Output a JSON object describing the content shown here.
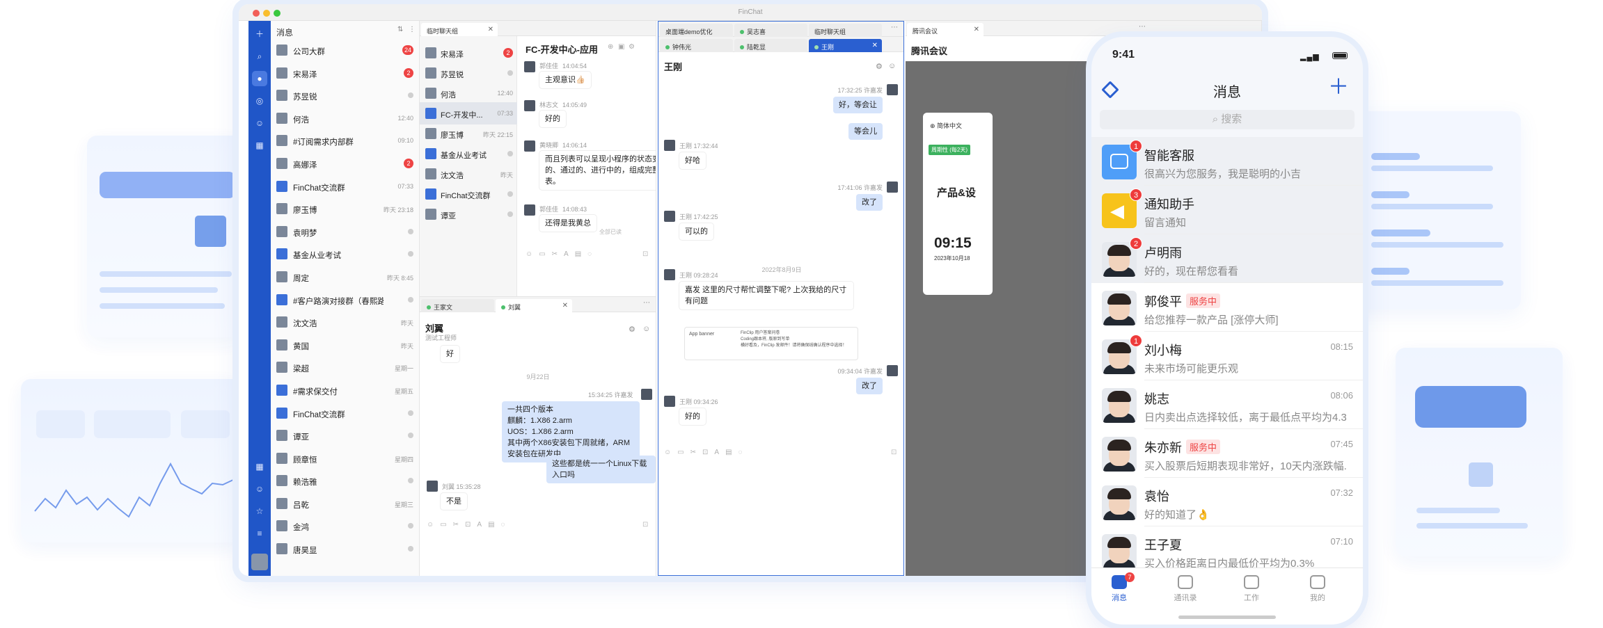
{
  "app": {
    "window_title": "FinChat",
    "rail_icons": [
      "plus-icon",
      "search-icon",
      "chat-icon",
      "subscription-icon",
      "contacts-icon",
      "apps-icon",
      "grid-icon",
      "person-icon",
      "star-icon",
      "menu-icon"
    ]
  },
  "conversations": {
    "header": "消息",
    "items": [
      {
        "name": "公司大群",
        "time": "",
        "badge": "24"
      },
      {
        "name": "宋易泽",
        "time": "",
        "badge": "2"
      },
      {
        "name": "苏昱锐",
        "time": "",
        "badge": ""
      },
      {
        "name": "何浩",
        "time": "12:40",
        "badge": ""
      },
      {
        "name": "#订阅需求内部群",
        "time": "09:10",
        "badge": ""
      },
      {
        "name": "高娜泽",
        "time": "",
        "badge": "2"
      },
      {
        "name": "FinChat交流群",
        "time": "07:33",
        "badge": ""
      },
      {
        "name": "廖玉博",
        "time": "昨天 23:18",
        "badge": ""
      },
      {
        "name": "袁明梦",
        "time": "",
        "badge": ""
      },
      {
        "name": "基金从业考试",
        "time": "",
        "badge": ""
      },
      {
        "name": "周定",
        "time": "昨天 8:45",
        "badge": ""
      },
      {
        "name": "#客户路演对接群（春熙路...",
        "time": "",
        "badge": ""
      },
      {
        "name": "沈文浩",
        "time": "昨天",
        "badge": ""
      },
      {
        "name": "黄国",
        "time": "昨天",
        "badge": ""
      },
      {
        "name": "梁超",
        "time": "星期一",
        "badge": ""
      },
      {
        "name": "#需求保交付",
        "time": "星期五",
        "badge": ""
      },
      {
        "name": "FinChat交流群",
        "time": "",
        "badge": ""
      },
      {
        "name": "谭亚",
        "time": "",
        "badge": ""
      },
      {
        "name": "顾章恒",
        "time": "星期四",
        "badge": ""
      },
      {
        "name": "赖浩雅",
        "time": "",
        "badge": ""
      },
      {
        "name": "吕乾",
        "time": "星期三",
        "badge": ""
      },
      {
        "name": "金鸿",
        "time": "",
        "badge": ""
      },
      {
        "name": "唐昊显",
        "time": "",
        "badge": ""
      }
    ]
  },
  "pane_temp": {
    "tab": "临时聊天组",
    "list": [
      {
        "name": "宋易泽",
        "time": "",
        "badge": "2"
      },
      {
        "name": "苏昱锐",
        "time": "",
        "badge": ""
      },
      {
        "name": "何浩",
        "time": "12:40",
        "badge": ""
      },
      {
        "name": "FC-开发中...",
        "time": "07:33",
        "badge": ""
      },
      {
        "name": "廖玉博",
        "time": "昨天 22:15",
        "badge": ""
      },
      {
        "name": "基金从业考试",
        "time": "",
        "badge": ""
      },
      {
        "name": "沈文浩",
        "time": "昨天",
        "badge": ""
      },
      {
        "name": "FinChat交流群",
        "time": "",
        "badge": ""
      },
      {
        "name": "谭亚",
        "time": "",
        "badge": ""
      }
    ],
    "chat_title": "FC-开发中心-应用",
    "messages": [
      {
        "sender": "郭佳佳",
        "time": "14:04:54",
        "text": "主观意识👍🏻"
      },
      {
        "sender": "林志文",
        "time": "14:05:49",
        "text": "好的"
      },
      {
        "sender": "黄晓卿",
        "time": "14:06:14",
        "text": "而且列表可以呈现小程序的状态变化。驳回的、通过的、进行中的，组成完整的状态列表。"
      },
      {
        "sender": "郭佳佳",
        "time": "14:08:43",
        "text": "还得是我黄总"
      }
    ],
    "read_note": "全部已读"
  },
  "pane_liuyi": {
    "tabs": [
      "王家文",
      "刘翼"
    ],
    "name": "刘翼",
    "role": "测试工程师",
    "top_text": "好",
    "date": "9月22日",
    "msg1_meta": "15:34:25  许嘉发",
    "msg1_text": "一共四个版本\n麒麟：1.X86    2.arm\nUOS：1.X86    2.arm\n其中两个X86安装包下周就绪，ARM安装包在研发中",
    "msg2_text": "这些都是统一一个Linux下载入口吗",
    "msg3_meta": "刘翼  15:35:28",
    "msg3_text": "不是"
  },
  "pane_wanggang": {
    "tabs_row1": [
      "桌面端demo优化",
      "吴志喜",
      "临时聊天组"
    ],
    "tabs_row2": [
      "钟伟光",
      "陆乾显",
      "王刚"
    ],
    "title": "王刚",
    "messages": [
      {
        "meta": "17:32:25  许嘉发",
        "text": "好，等会让",
        "me": true
      },
      {
        "meta": "",
        "text": "等会儿",
        "me": true
      },
      {
        "meta": "王刚  17:32:44",
        "text": "好哈",
        "me": false
      },
      {
        "meta": "17:41:06  许嘉发",
        "text": "改了",
        "me": true
      },
      {
        "meta": "王刚  17:42:25",
        "text": "可以的",
        "me": false
      },
      {
        "meta": "王刚  09:28:24",
        "text": "嘉发 这里的尺寸帮忙调整下呢? 上次我给的尺寸有问题",
        "me": false
      },
      {
        "meta": "09:34:04  许嘉发",
        "text": "改了",
        "me": true
      },
      {
        "meta": "王刚  09:34:26",
        "text": "好的",
        "me": false
      }
    ],
    "date": "2022年8月9日",
    "attach_left": "App banner",
    "attach_right": "FinClip 用户答案问卷\nCoding跟本将, 版原到写单\n横好看及，FinClip 发邮件！请将确保线确认程序中选择！"
  },
  "pane_meeting": {
    "tab": "腾讯会议",
    "title": "腾讯会议",
    "lang": "简体中文",
    "tag": "周期性 (每2天)",
    "event": "产品&设",
    "time": "09:15",
    "date": "2023年10月18"
  },
  "phone": {
    "status_time": "9:41",
    "title": "消息",
    "search_placeholder": "搜索",
    "rows": [
      {
        "name": "智能客服",
        "sub": "很高兴为您服务，我是聪明的小吉",
        "time": "",
        "badge": "1",
        "tag": ""
      },
      {
        "name": "通知助手",
        "sub": "留言通知",
        "time": "",
        "badge": "3",
        "tag": ""
      },
      {
        "name": "卢明雨",
        "sub": "好的，现在帮您看看",
        "time": "",
        "badge": "2",
        "tag": ""
      },
      {
        "name": "郭俊平",
        "sub": "给您推荐一款产品 [涨停大师]",
        "time": "",
        "badge": "",
        "tag": "服务中"
      },
      {
        "name": "刘小梅",
        "sub": "未来市场可能更乐观",
        "time": "08:15",
        "badge": "1",
        "tag": ""
      },
      {
        "name": "姚志",
        "sub": "日内卖出点选择较低，离于最低点平均为4.3...",
        "time": "08:06",
        "badge": "",
        "tag": ""
      },
      {
        "name": "朱亦新",
        "sub": "买入股票后短期表现非常好，10天内涨跌幅...",
        "time": "07:45",
        "badge": "",
        "tag": "服务中"
      },
      {
        "name": "袁怡",
        "sub": "好的知道了👌",
        "time": "07:32",
        "badge": "",
        "tag": ""
      },
      {
        "name": "王子夏",
        "sub": "买入价格距离日内最低价平均为0.3%",
        "time": "07:10",
        "badge": "",
        "tag": ""
      }
    ],
    "tabs": [
      {
        "label": "消息",
        "badge": "7"
      },
      {
        "label": "通讯录",
        "badge": ""
      },
      {
        "label": "工作",
        "badge": ""
      },
      {
        "label": "我的",
        "badge": ""
      }
    ]
  },
  "colors": {
    "brand": "#2056c8",
    "accent": "#2a5fd0",
    "badge_red": "#ee4444",
    "my_bubble": "#d6e4fb"
  }
}
